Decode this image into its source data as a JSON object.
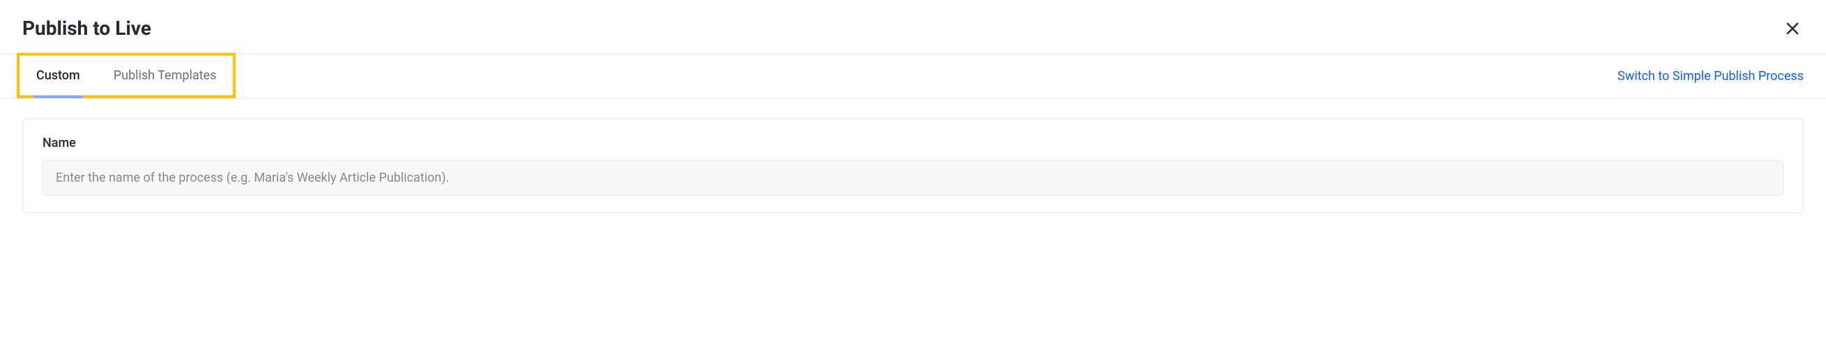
{
  "header": {
    "title": "Publish to Live"
  },
  "tabs": {
    "custom": "Custom",
    "publishTemplates": "Publish Templates"
  },
  "switchLink": "Switch to Simple Publish Process",
  "form": {
    "nameLabel": "Name",
    "namePlaceholder": "Enter the name of the process (e.g. Maria's Weekly Article Publication)."
  }
}
